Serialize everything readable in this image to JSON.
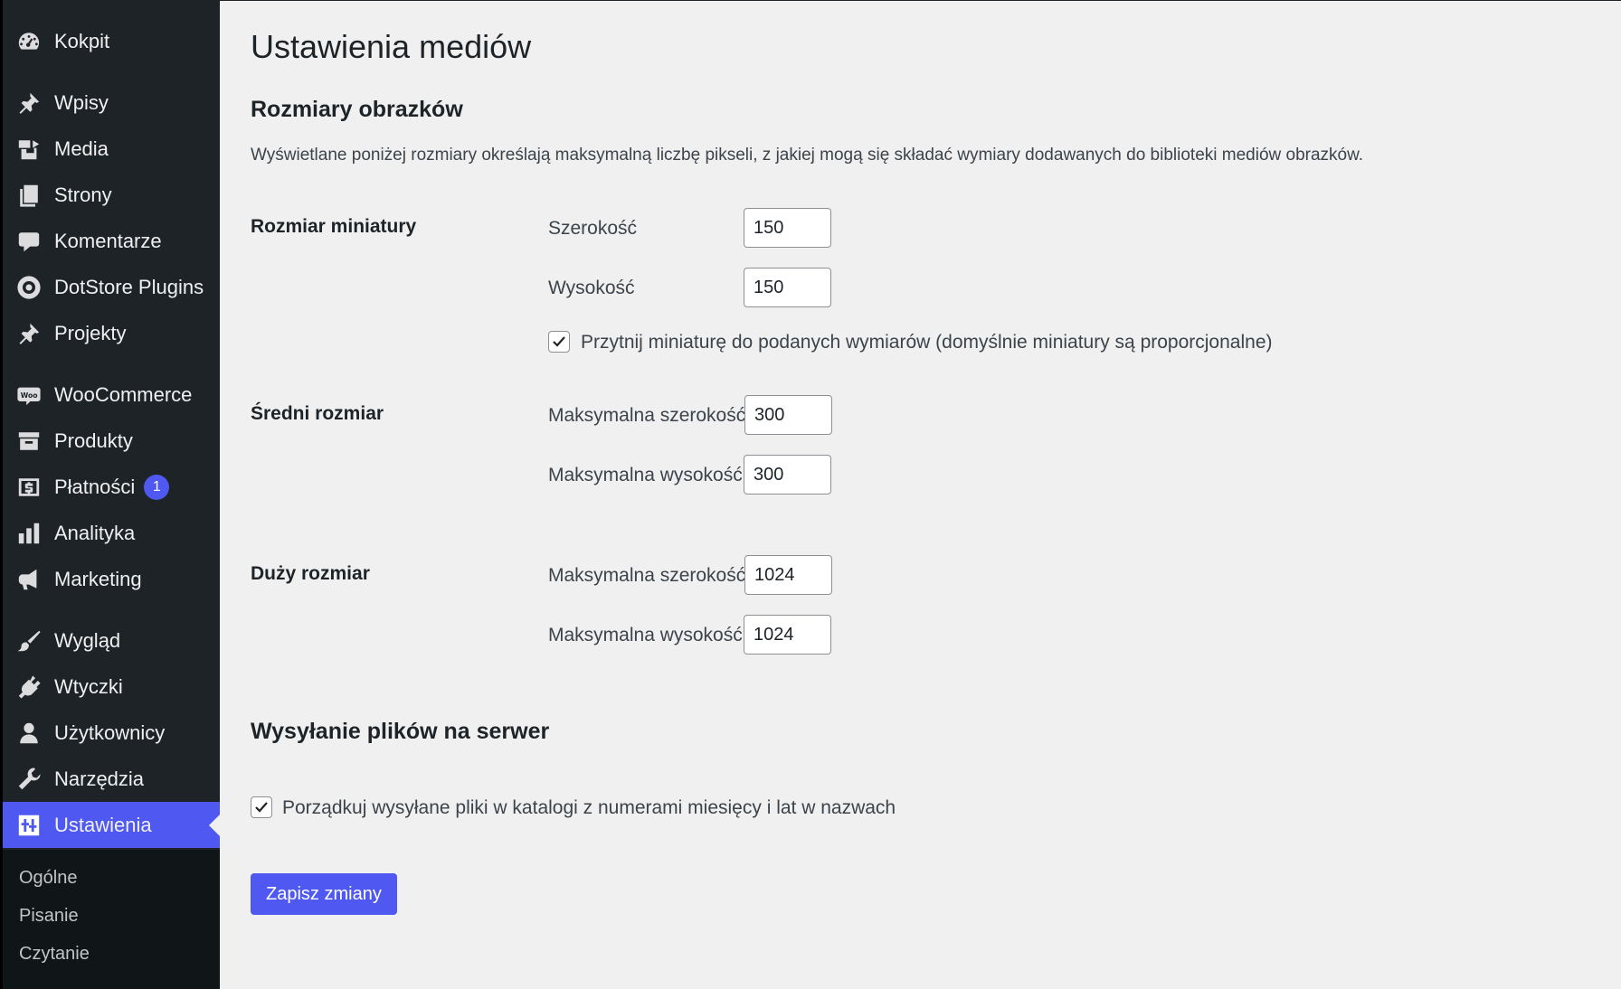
{
  "sidebar": {
    "items": [
      {
        "label": "Kokpit",
        "icon": "dashboard-icon"
      },
      {
        "label": "Wpisy",
        "icon": "pin-icon"
      },
      {
        "label": "Media",
        "icon": "media-icon"
      },
      {
        "label": "Strony",
        "icon": "pages-icon"
      },
      {
        "label": "Komentarze",
        "icon": "comment-icon"
      },
      {
        "label": "DotStore Plugins",
        "icon": "dotstore-icon"
      },
      {
        "label": "Projekty",
        "icon": "pin-icon"
      },
      {
        "label": "WooCommerce",
        "icon": "woo-icon"
      },
      {
        "label": "Produkty",
        "icon": "archive-icon"
      },
      {
        "label": "Płatności",
        "icon": "dollar-icon",
        "badge": "1"
      },
      {
        "label": "Analityka",
        "icon": "chart-icon"
      },
      {
        "label": "Marketing",
        "icon": "megaphone-icon"
      },
      {
        "label": "Wygląd",
        "icon": "brush-icon"
      },
      {
        "label": "Wtyczki",
        "icon": "plugin-icon"
      },
      {
        "label": "Użytkownicy",
        "icon": "user-icon"
      },
      {
        "label": "Narzędzia",
        "icon": "wrench-icon"
      },
      {
        "label": "Ustawienia",
        "icon": "settings-icon",
        "active": true
      }
    ],
    "submenu": [
      "Ogólne",
      "Pisanie",
      "Czytanie"
    ]
  },
  "page": {
    "title": "Ustawienia mediów",
    "image_sizes_title": "Rozmiary obrazków",
    "description": "Wyświetlane poniżej rozmiary określają maksymalną liczbę pikseli, z jakiej mogą się składać wymiary dodawanych do biblioteki mediów obrazków.",
    "thumbnail": {
      "label": "Rozmiar miniatury",
      "width_label": "Szerokość",
      "width_value": "150",
      "height_label": "Wysokość",
      "height_value": "150",
      "crop_label": "Przytnij miniaturę do podanych wymiarów (domyślnie miniatury są proporcjonalne)",
      "crop_checked": true
    },
    "medium": {
      "label": "Średni rozmiar",
      "width_label": "Maksymalna szerokość",
      "width_value": "300",
      "height_label": "Maksymalna wysokość",
      "height_value": "300"
    },
    "large": {
      "label": "Duży rozmiar",
      "width_label": "Maksymalna szerokość",
      "width_value": "1024",
      "height_label": "Maksymalna wysokość",
      "height_value": "1024"
    },
    "uploads_title": "Wysyłanie plików na serwer",
    "uploads_label": "Porządkuj wysyłane pliki w katalogi z numerami miesięcy i lat w nazwach",
    "uploads_checked": true,
    "save_label": "Zapisz zmiany"
  },
  "colors": {
    "accent": "#4f59f1",
    "sidebar_bg": "#1d2327",
    "page_bg": "#f0f0f1"
  }
}
